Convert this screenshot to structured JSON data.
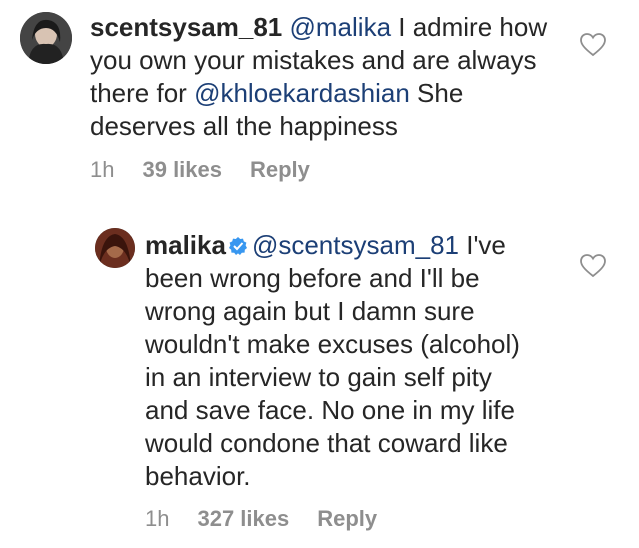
{
  "comments": [
    {
      "username": "scentsysam_81",
      "mention": "@malika",
      "text_a": " I admire how you own your mistakes and are always there for ",
      "mention2": "@khloekardashian",
      "text_b": " She deserves all the happiness",
      "time": "1h",
      "likes": "39 likes",
      "reply": "Reply",
      "avatar_icon": "profile-photo",
      "like_icon": "heart-outline-icon"
    },
    {
      "username": "malika",
      "verified_icon": "verified-badge-icon",
      "mention": "@scentsysam_81",
      "text_a": " I've been wrong before and I'll be wrong again but I damn sure wouldn't make excuses (alcohol) in an interview to gain self pity and save face. No one in my life would condone that coward like behavior.",
      "time": "1h",
      "likes": "327 likes",
      "reply": "Reply",
      "avatar_icon": "profile-photo",
      "like_icon": "heart-outline-icon"
    }
  ],
  "colors": {
    "text": "#262626",
    "mention": "#1c3f76",
    "meta": "#8e8e8e",
    "verified": "#3897f0"
  }
}
